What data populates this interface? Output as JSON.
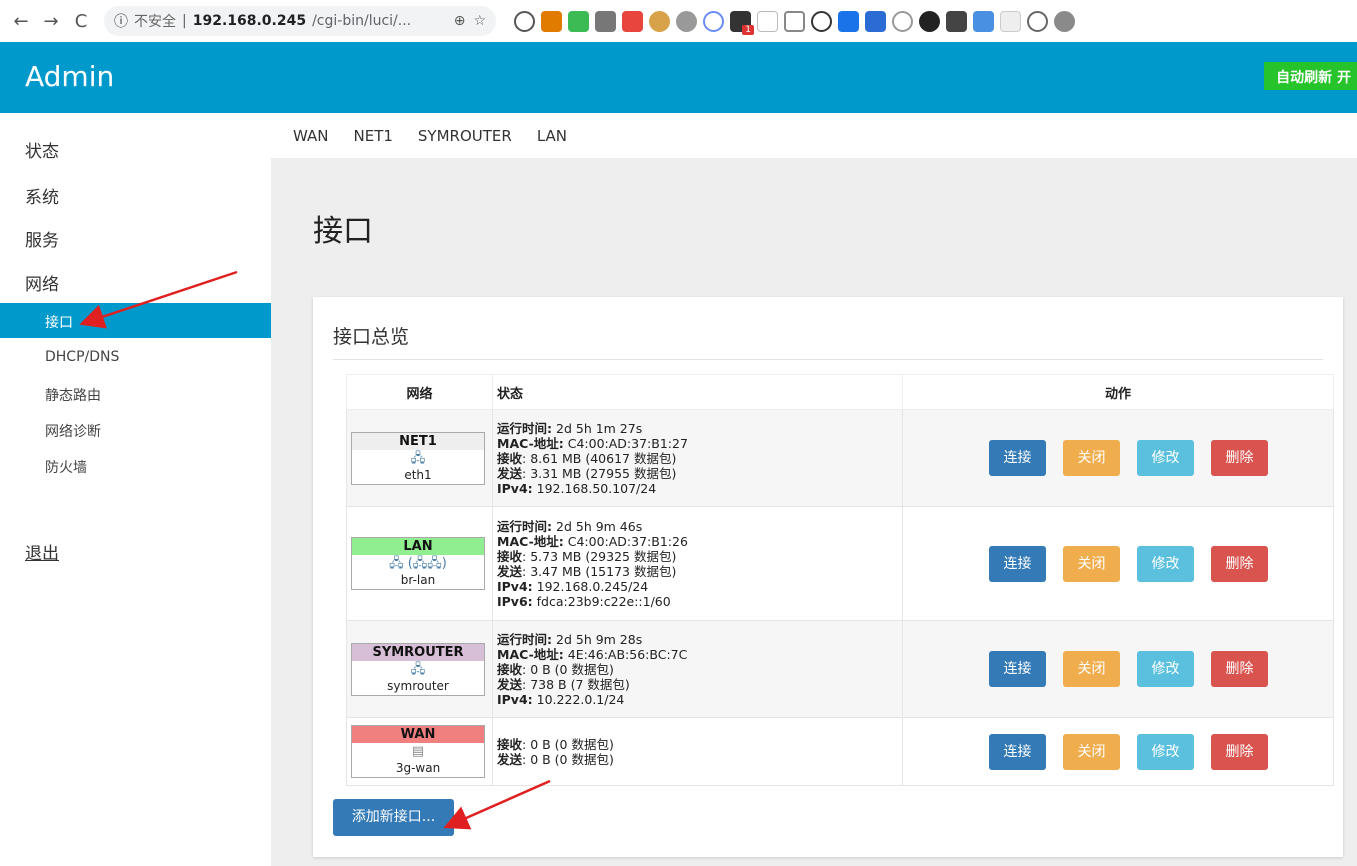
{
  "browser": {
    "back": "←",
    "forward": "→",
    "reload": "C",
    "security_label": "不安全",
    "url_host": "192.168.0.245",
    "url_path": "/cgi-bin/luci/...",
    "ext_badge_count": "1"
  },
  "header": {
    "brand": "Admin",
    "auto_refresh": "自动刷新 开"
  },
  "sidebar": {
    "items": [
      "状态",
      "系统",
      "服务",
      "网络"
    ],
    "sub_items": [
      "接口",
      "DHCP/DNS",
      "静态路由",
      "网络诊断",
      "防火墙"
    ],
    "active_sub": "接口",
    "logout": "退出"
  },
  "tabs": [
    "WAN",
    "NET1",
    "SYMROUTER",
    "LAN"
  ],
  "page": {
    "title": "接口",
    "panel_title": "接口总览",
    "add_button": "添加新接口..."
  },
  "table": {
    "headers": {
      "network": "网络",
      "status": "状态",
      "action": "动作"
    },
    "buttons": {
      "connect": "连接",
      "close": "关闭",
      "edit": "修改",
      "delete": "删除"
    },
    "rows": [
      {
        "name": "NET1",
        "name_color": "#eeeeee",
        "device": "eth1",
        "stats": [
          {
            "k": "运行时间",
            "v": "2d 5h 1m 27s"
          },
          {
            "k": "MAC-地址",
            "v": "C4:00:AD:37:B1:27"
          },
          {
            "k": "接收",
            "v": "8.61 MB (40617 数据包)"
          },
          {
            "k": "发送",
            "v": "3.31 MB (27955 数据包)"
          },
          {
            "k": "IPv4",
            "v": "192.168.50.107/24"
          }
        ]
      },
      {
        "name": "LAN",
        "name_color": "#90ee90",
        "device": "br-lan",
        "stats": [
          {
            "k": "运行时间",
            "v": "2d 5h 9m 46s"
          },
          {
            "k": "MAC-地址",
            "v": "C4:00:AD:37:B1:26"
          },
          {
            "k": "接收",
            "v": "5.73 MB (29325 数据包)"
          },
          {
            "k": "发送",
            "v": "3.47 MB (15173 数据包)"
          },
          {
            "k": "IPv4",
            "v": "192.168.0.245/24"
          },
          {
            "k": "IPv6",
            "v": "fdca:23b9:c22e::1/60"
          }
        ]
      },
      {
        "name": "SYMROUTER",
        "name_color": "#d8bfd8",
        "device": "symrouter",
        "stats": [
          {
            "k": "运行时间",
            "v": "2d 5h 9m 28s"
          },
          {
            "k": "MAC-地址",
            "v": "4E:46:AB:56:BC:7C"
          },
          {
            "k": "接收",
            "v": "0 B (0 数据包)"
          },
          {
            "k": "发送",
            "v": "738 B (7 数据包)"
          },
          {
            "k": "IPv4",
            "v": "10.222.0.1/24"
          }
        ]
      },
      {
        "name": "WAN",
        "name_color": "#f08080",
        "device": "3g-wan",
        "stats": [
          {
            "k": "接收",
            "v": "0 B (0 数据包)"
          },
          {
            "k": "发送",
            "v": "0 B (0 数据包)"
          }
        ]
      }
    ]
  },
  "colors": {
    "brand_blue": "#0099cc",
    "badge_green": "#27c32b",
    "annotation_red": "#e02020"
  }
}
